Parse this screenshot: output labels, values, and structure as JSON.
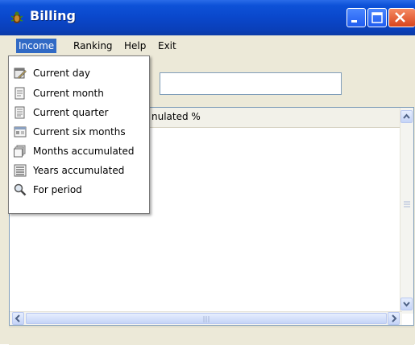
{
  "window": {
    "title": "Billing",
    "icon": "bug-icon"
  },
  "titlebar_buttons": [
    "minimize",
    "maximize",
    "close"
  ],
  "menubar": {
    "items": [
      {
        "label": "Income",
        "active": true
      },
      {
        "label": "Ranking",
        "active": false
      },
      {
        "label": "Help",
        "active": false
      },
      {
        "label": "Exit",
        "active": false
      }
    ]
  },
  "income_menu": {
    "items": [
      {
        "label": "Current day",
        "icon": "calendar-pencil-icon"
      },
      {
        "label": "Current month",
        "icon": "document-icon"
      },
      {
        "label": "Current quarter",
        "icon": "document-icon"
      },
      {
        "label": "Current six months",
        "icon": "window-icon"
      },
      {
        "label": "Months accumulated",
        "icon": "stack-icon"
      },
      {
        "label": "Years accumulated",
        "icon": "list-icon"
      },
      {
        "label": "For period",
        "icon": "magnifier-icon"
      }
    ]
  },
  "search": {
    "value": ""
  },
  "grid": {
    "column_header": "nulated %"
  },
  "colors": {
    "titlebar": "#0a47cb",
    "menu_highlight": "#316ac5",
    "window_bg": "#ece9d8"
  }
}
